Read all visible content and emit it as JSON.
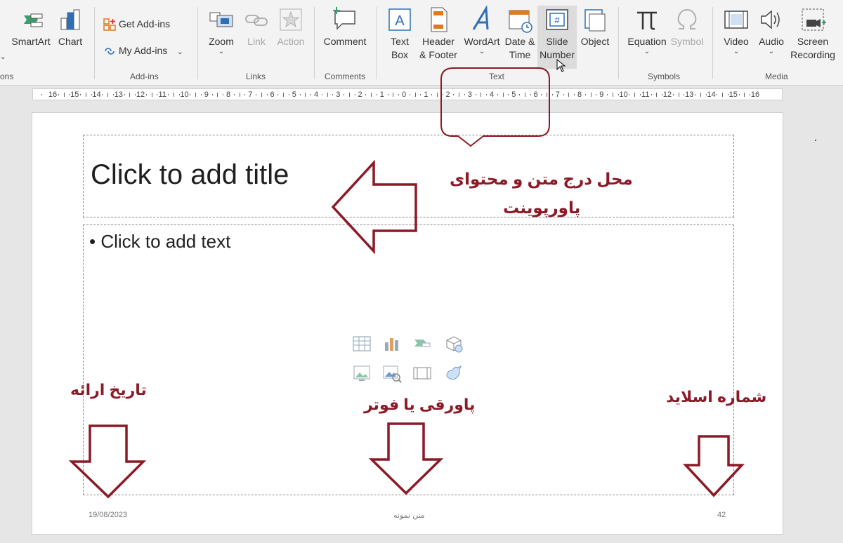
{
  "ribbon": {
    "buttons": {
      "smartart": "SmartArt",
      "chart": "Chart",
      "get_addins": "Get Add-ins",
      "my_addins": "My Add-ins",
      "zoom": "Zoom",
      "link": "Link",
      "action": "Action",
      "comment": "Comment",
      "textbox_1": "Text",
      "textbox_2": "Box",
      "header_1": "Header",
      "header_2": "& Footer",
      "wordart": "WordArt",
      "date_1": "Date &",
      "date_2": "Time",
      "slidenum_1": "Slide",
      "slidenum_2": "Number",
      "object": "Object",
      "equation": "Equation",
      "symbol": "Symbol",
      "video": "Video",
      "audio": "Audio",
      "screen_1": "Screen",
      "screen_2": "Recording"
    },
    "groups": {
      "illustrations_partial": "ons",
      "addins": "Add-ins",
      "links": "Links",
      "comments": "Comments",
      "text": "Text",
      "symbols": "Symbols",
      "media": "Media"
    },
    "dropdown_glyph": "⌄"
  },
  "ruler": {
    "ticks": [
      "16",
      "15",
      "14",
      "13",
      "12",
      "11",
      "10",
      "9",
      "8",
      "7",
      "6",
      "5",
      "4",
      "3",
      "2",
      "1",
      "0",
      "1",
      "2",
      "3",
      "4",
      "5",
      "6",
      "7",
      "8",
      "9",
      "10",
      "11",
      "12",
      "13",
      "14",
      "15",
      "16"
    ]
  },
  "slide": {
    "title_placeholder": "Click to add title",
    "body_placeholder": "• Click to add text",
    "footer_date": "19/08/2023",
    "footer_text": "متن نمونه",
    "footer_number": "42"
  },
  "annotations": {
    "content_label_line1": "محل درج متن و محتوای",
    "content_label_line2": "پاورپوینت",
    "date_label": "تاریخ ارائه",
    "footer_label": "پاورقی یا فوتر",
    "number_label": "شماره اسلاید"
  },
  "colors": {
    "annotation": "#8b1a26",
    "ribbon_bg": "#f3f3f3",
    "icon_blue": "#2f6fb8",
    "icon_orange": "#e07a1f"
  }
}
